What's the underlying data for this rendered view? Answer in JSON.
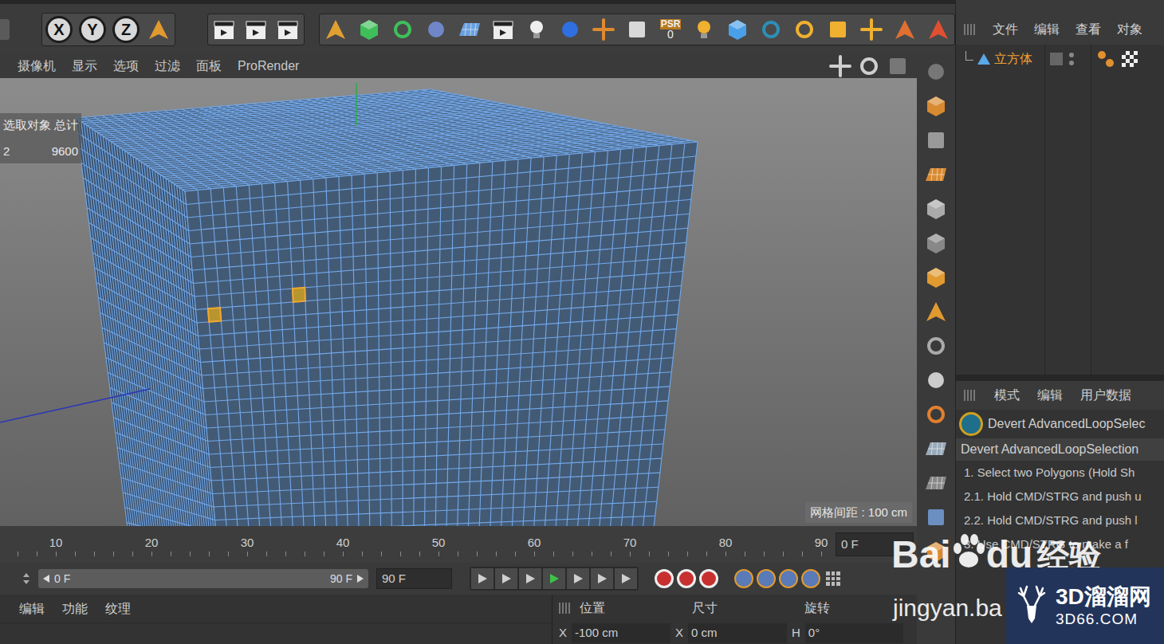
{
  "toolbar": {
    "axes": [
      "X",
      "Y",
      "Z"
    ],
    "psr": {
      "label": "PSR",
      "value": "0"
    }
  },
  "viewport": {
    "menu": [
      "摄像机",
      "显示",
      "选项",
      "过滤",
      "面板",
      "ProRender"
    ],
    "hud": {
      "headers": [
        "选取对象",
        "总计"
      ],
      "values": [
        "2",
        "9600"
      ]
    },
    "grid_spacing": "网格间距 : 100 cm",
    "selected_polygons": [
      {
        "face": "front",
        "row": 9,
        "col": 1,
        "selected": true
      },
      {
        "face": "front",
        "row": 8,
        "col": 8,
        "selected": true
      }
    ]
  },
  "timeline": {
    "ticks": [
      "10",
      "20",
      "30",
      "40",
      "50",
      "60",
      "70",
      "80",
      "90"
    ],
    "current": "0 F"
  },
  "range": {
    "start": "0 F",
    "end": "90 F",
    "end_field": "90 F"
  },
  "material_panel": {
    "menu": [
      "编辑",
      "功能",
      "纹理"
    ]
  },
  "coordinates": {
    "headers": [
      "位置",
      "尺寸",
      "旋转"
    ],
    "fields": [
      {
        "axis": "X",
        "value": "-100 cm"
      },
      {
        "axis": "X",
        "value": "0 cm"
      },
      {
        "axis": "H",
        "value": "0°"
      }
    ]
  },
  "object_manager": {
    "menu": [
      "文件",
      "编辑",
      "查看",
      "对象"
    ],
    "objects": [
      {
        "name": "立方体",
        "selected": true
      }
    ]
  },
  "attributes": {
    "menu": [
      "模式",
      "编辑",
      "用户数据"
    ],
    "plugin": "Devert AdvancedLoopSelec",
    "section": "Devert AdvancedLoopSelection",
    "lines": [
      "1. Select two Polygons (Hold Sh",
      "2.1. Hold CMD/STRG and push u",
      "2.2. Hold CMD/STRG and push l",
      "3. Use CMD/STRG to make a f"
    ]
  },
  "watermarks": {
    "baidu": {
      "parts": [
        "Bai",
        "du",
        "经验"
      ],
      "url": "jingyan.ba"
    },
    "site": {
      "name": "3D溜溜网",
      "url": "3D66.COM"
    }
  }
}
